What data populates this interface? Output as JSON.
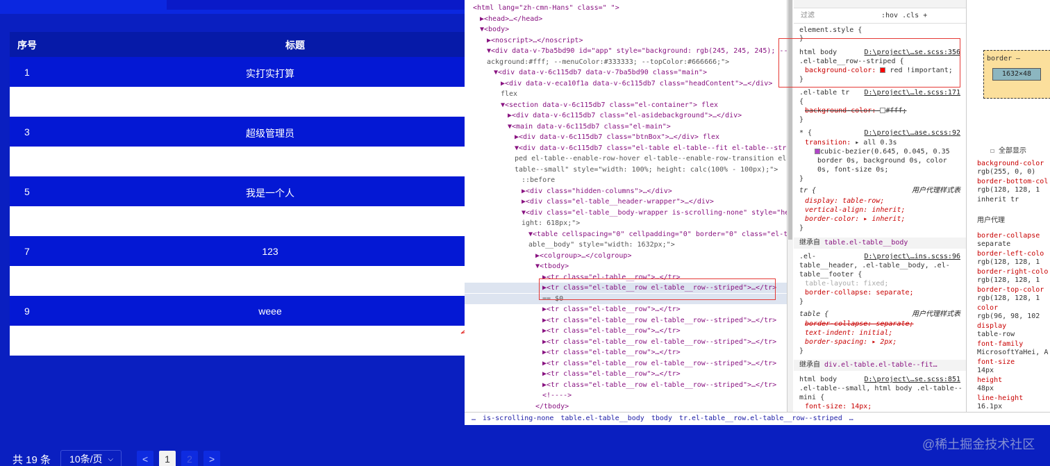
{
  "table": {
    "headers": {
      "index": "序号",
      "title": "标题"
    },
    "rows": [
      {
        "index": "1",
        "title": "实打实打算"
      },
      {
        "index": "",
        "title": ""
      },
      {
        "index": "3",
        "title": "超级管理员"
      },
      {
        "index": "",
        "title": ""
      },
      {
        "index": "5",
        "title": "我是一个人"
      },
      {
        "index": "",
        "title": ""
      },
      {
        "index": "7",
        "title": "123"
      },
      {
        "index": "",
        "title": ""
      },
      {
        "index": "9",
        "title": "weee"
      },
      {
        "index": "",
        "title": ""
      }
    ]
  },
  "pagination": {
    "total": "共 19 条",
    "page_size": "10条/页",
    "prev": "<",
    "pages": [
      "1",
      "2"
    ],
    "next": ">"
  },
  "watermark": "@稀土掘金技术社区",
  "devtools": {
    "dom_lines": [
      {
        "indent": 0,
        "text": "<html lang=\"zh-cmn-Hans\" class=\" \">"
      },
      {
        "indent": 1,
        "text": "▶<head>…</head>"
      },
      {
        "indent": 1,
        "text": "▼<body>"
      },
      {
        "indent": 2,
        "text": "▶<noscript>…</noscript>"
      },
      {
        "indent": 2,
        "text": "▼<div data-v-7ba5bd90 id=\"app\" style=\"background: rgb(245, 245, 245); --b"
      },
      {
        "indent": 2,
        "text": "ackground:#fff; --menuColor:#333333; --topColor:#666666;\">"
      },
      {
        "indent": 3,
        "text": "▼<div data-v-6c115db7 data-v-7ba5bd90 class=\"main\">"
      },
      {
        "indent": 4,
        "text": "▶<div data-v-eca10f1a data-v-6c115db7 class=\"headContent\">…</div>"
      },
      {
        "indent": 4,
        "text": "flex"
      },
      {
        "indent": 4,
        "text": "▼<section data-v-6c115db7 class=\"el-container\"> flex"
      },
      {
        "indent": 5,
        "text": "▶<div data-v-6c115db7 class=\"el-asidebackground\">…</div>"
      },
      {
        "indent": 5,
        "text": "▼<main data-v-6c115db7 class=\"el-main\">"
      },
      {
        "indent": 6,
        "text": "▶<div data-v-6c115db7 class=\"btnBox\">…</div> flex"
      },
      {
        "indent": 6,
        "text": "▼<div data-v-6c115db7 class=\"el-table el-table--fit el-table--stri"
      },
      {
        "indent": 6,
        "text": "ped el-table--enable-row-hover el-table--enable-row-transition el-"
      },
      {
        "indent": 6,
        "text": "table--small\" style=\"width: 100%; height: calc(100% - 100px);\">"
      },
      {
        "indent": 7,
        "text": "::before"
      },
      {
        "indent": 7,
        "text": "▶<div class=\"hidden-columns\">…</div>"
      },
      {
        "indent": 7,
        "text": "▶<div class=\"el-table__header-wrapper\">…</div>"
      },
      {
        "indent": 7,
        "text": "▼<div class=\"el-table__body-wrapper is-scrolling-none\" style=\"he"
      },
      {
        "indent": 7,
        "text": "ight: 618px;\">"
      },
      {
        "indent": 8,
        "text": "▼<table cellspacing=\"0\" cellpadding=\"0\" border=\"0\" class=\"el-t"
      },
      {
        "indent": 8,
        "text": "able__body\" style=\"width: 1632px;\">"
      },
      {
        "indent": 9,
        "text": "▶<colgroup>…</colgroup>"
      },
      {
        "indent": 9,
        "text": "▼<tbody>"
      },
      {
        "indent": 10,
        "text": "▶<tr class=\"el-table__row\">…</tr>"
      },
      {
        "indent": 10,
        "text": "▶<tr class=\"el-table__row el-table__row--striped\">…</tr>"
      },
      {
        "indent": 10,
        "text": "== $0"
      },
      {
        "indent": 10,
        "text": "▶<tr class=\"el-table__row\">…</tr>"
      },
      {
        "indent": 10,
        "text": "▶<tr class=\"el-table__row el-table__row--striped\">…</tr>"
      },
      {
        "indent": 10,
        "text": "▶<tr class=\"el-table__row\">…</tr>"
      },
      {
        "indent": 10,
        "text": "▶<tr class=\"el-table__row el-table__row--striped\">…</tr>"
      },
      {
        "indent": 10,
        "text": "▶<tr class=\"el-table__row\">…</tr>"
      },
      {
        "indent": 10,
        "text": "▶<tr class=\"el-table__row el-table__row--striped\">…</tr>"
      },
      {
        "indent": 10,
        "text": "▶<tr class=\"el-table__row\">…</tr>"
      },
      {
        "indent": 10,
        "text": "▶<tr class=\"el-table__row el-table__row--striped\">…</tr>"
      },
      {
        "indent": 10,
        "text": "<!---->"
      },
      {
        "indent": 9,
        "text": "</tbody>"
      }
    ],
    "breadcrumbs": [
      "…",
      "is-scrolling-none",
      "table.el-table__body",
      "tbody",
      "tr.el-table__row.el-table__row--striped",
      "…"
    ],
    "styles": {
      "filter_placeholder": "过滤",
      "tools": ":hov  .cls  +",
      "element_style": "element.style {",
      "rule1_selector": "html body",
      "rule1_selector2": ".el-table__row--striped {",
      "rule1_src": "D:\\project\\…se.scss:356",
      "rule1_prop": "background-color:",
      "rule1_val": "red !important;",
      "rule2_selector": ".el-table tr",
      "rule2_src": "D:\\project\\…le.scss:171",
      "rule2_prop": "background-color:",
      "rule2_val": "#fff;",
      "rule3_selector": "* {",
      "rule3_src": "D:\\project\\…ase.scss:92",
      "rule3_prop": "transition:",
      "rule3_val1": "all 0.3s",
      "rule3_val2": "cubic-bezier(0.645, 0.045, 0.35",
      "rule3_val3": "border 0s, background 0s, color",
      "rule3_val4": "0s, font-size 0s;",
      "ua1_selector": "tr {",
      "ua_label": "用户代理样式表",
      "ua1_p1": "display: table-row;",
      "ua1_p2": "vertical-align: inherit;",
      "ua1_p3": "border-color: ▸ inherit;",
      "inherit1_label": "继承自",
      "inherit1_target": "table.el-table__body",
      "rule4_selector": ".el-",
      "rule4_src": "D:\\project\\…ins.scss:96",
      "rule4_sel2": "table__header, .el-table__body, .el-",
      "rule4_sel3": "table__footer {",
      "rule4_p1": "table-layout: fixed;",
      "rule4_p2": "border-collapse: separate;",
      "ua2_selector": "table {",
      "ua2_p1": "border-collapse: separate;",
      "ua2_p2": "text-indent: initial;",
      "ua2_p3": "border-spacing: ▸ 2px;",
      "inherit2_label": "继承自",
      "inherit2_target": "div.el-table.el-table--fit…",
      "rule5_selector": "html body",
      "rule5_src": "D:\\project\\…se.scss:851",
      "rule5_sel2": ".el-table--small, html body .el-table--",
      "rule5_sel3": "mini {",
      "rule5_p1": "font-size: 14px;"
    },
    "computed": {
      "box_label": "border",
      "box_dash": "–",
      "box_size": "1632×48",
      "show_all": "全部显示",
      "props": [
        {
          "k": "background-color",
          "v": "rgb(255, 0, 0)"
        },
        {
          "k": "border-bottom-col",
          "v": "rgb(128, 128, 1"
        },
        {
          "k": "",
          "v": "inherit        tr"
        },
        {
          "k": "",
          "v": "用户代理"
        },
        {
          "k": "border-collapse",
          "v": "separate"
        },
        {
          "k": "border-left-colo",
          "v": "rgb(128, 128, 1"
        },
        {
          "k": "border-right-colo",
          "v": "rgb(128, 128, 1"
        },
        {
          "k": "border-top-color",
          "v": "rgb(128, 128, 1"
        },
        {
          "k": "color",
          "v": "rgb(96, 98, 102"
        },
        {
          "k": "display",
          "v": "table-row"
        },
        {
          "k": "font-family",
          "v": "MicrosoftYaHei, A"
        },
        {
          "k": "font-size",
          "v": "14px"
        },
        {
          "k": "height",
          "v": "48px"
        },
        {
          "k": "line-height",
          "v": "16.1px"
        }
      ]
    }
  },
  "colors": {
    "accent": "#0a1fc0",
    "striped_row": "#ffffff",
    "highlight": "#e53935"
  }
}
